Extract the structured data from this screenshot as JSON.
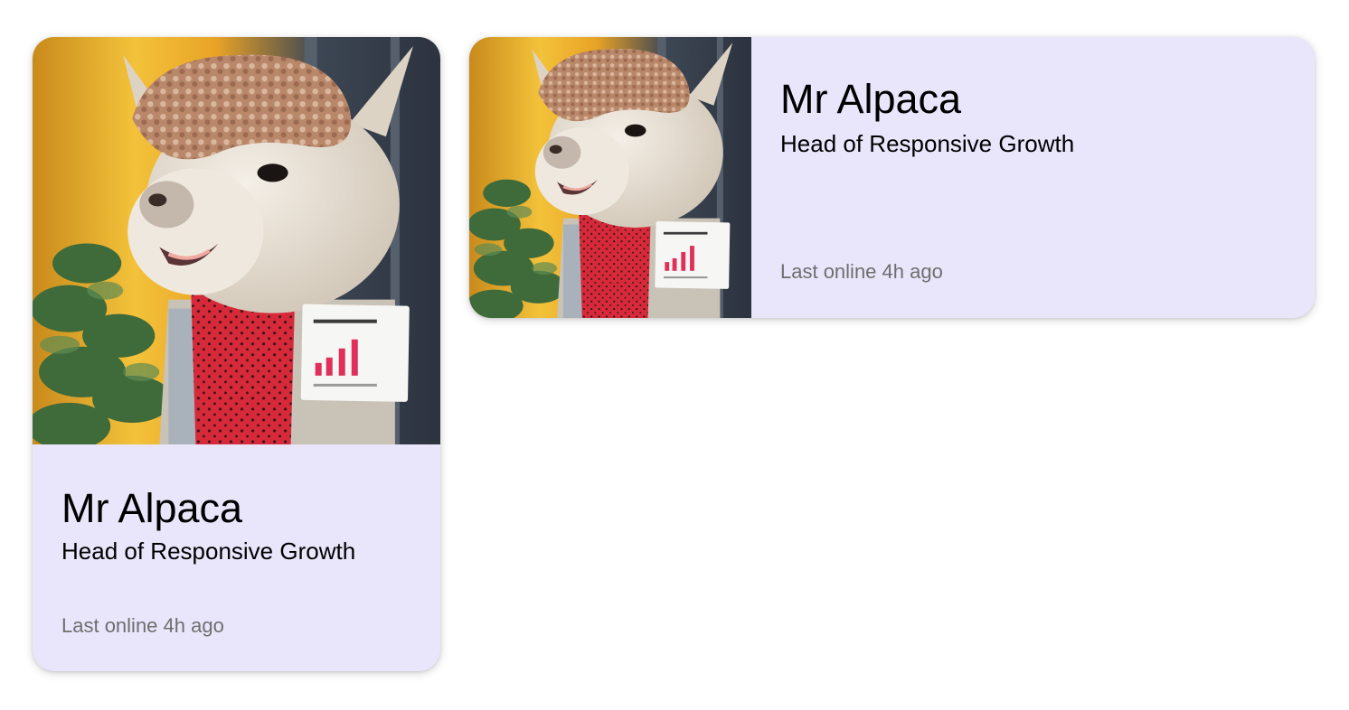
{
  "cards": [
    {
      "layout": "vertical",
      "name": "Mr Alpaca",
      "role": "Head of Responsive Growth",
      "status": "Last online 4h ago",
      "photo_alt": "alpaca-photo"
    },
    {
      "layout": "horizontal",
      "name": "Mr Alpaca",
      "role": "Head of Responsive Growth",
      "status": "Last online 4h ago",
      "photo_alt": "alpaca-photo"
    }
  ],
  "colors": {
    "card_background": "#e9e6fc",
    "name_text": "#000000",
    "status_text": "#6e6e6e",
    "scarf": "#d62a3a",
    "chart_bars": "#e0305a"
  }
}
